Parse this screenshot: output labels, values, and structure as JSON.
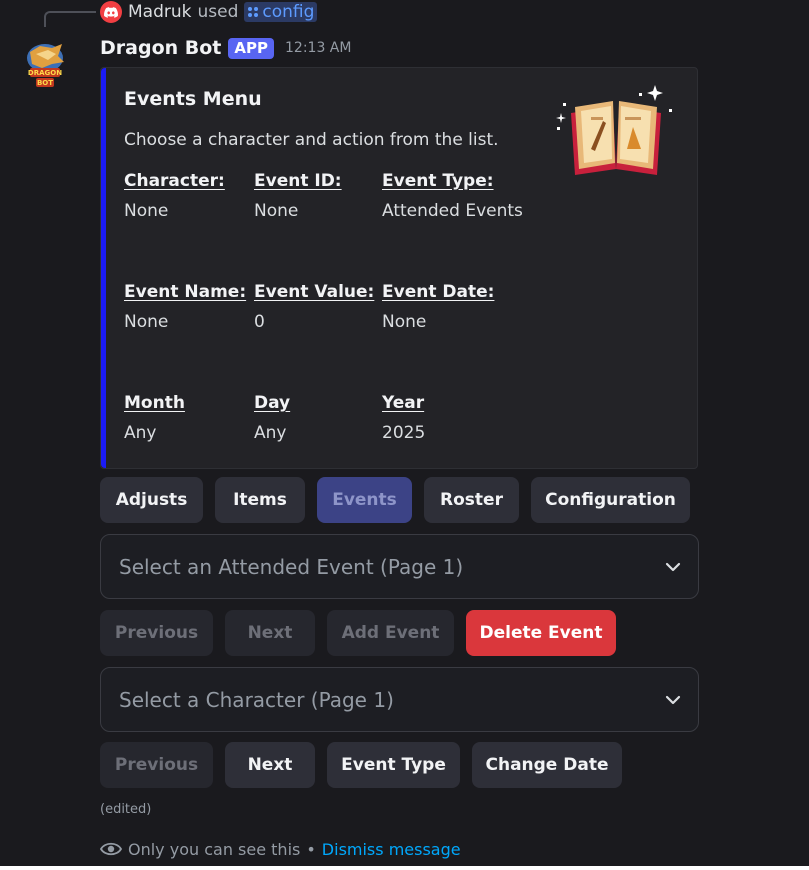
{
  "reply": {
    "user": "Madruk",
    "action_text": "used",
    "command": "config"
  },
  "message": {
    "bot_name": "Dragon Bot",
    "app_tag": "APP",
    "timestamp": "12:13 AM"
  },
  "embed": {
    "accent_color": "#1b1bf5",
    "title": "Events Menu",
    "description": "Choose a character and action from the list.",
    "fields": [
      {
        "name": "Character:",
        "value": "None"
      },
      {
        "name": "Event ID:",
        "value": "None"
      },
      {
        "name": "Event Type:",
        "value": "Attended Events"
      },
      {
        "name": "Event Name:",
        "value": "None"
      },
      {
        "name": "Event Value:",
        "value": "0"
      },
      {
        "name": "Event Date:",
        "value": "None"
      },
      {
        "name": "Month",
        "value": "Any"
      },
      {
        "name": "Day",
        "value": "Any"
      },
      {
        "name": "Year",
        "value": "2025"
      }
    ]
  },
  "nav_buttons": [
    "Adjusts",
    "Items",
    "Events",
    "Roster",
    "Configuration"
  ],
  "event_select": {
    "placeholder": "Select an Attended Event (Page 1)"
  },
  "event_actions": [
    "Previous",
    "Next",
    "Add Event",
    "Delete Event"
  ],
  "character_select": {
    "placeholder": "Select a Character (Page 1)"
  },
  "character_actions": [
    "Previous",
    "Next",
    "Event Type",
    "Change Date"
  ],
  "footer": {
    "edited": "(edited)",
    "ephemeral_text": "Only you can see this",
    "separator": "•",
    "dismiss": "Dismiss message"
  },
  "colors": {
    "danger": "#da373c",
    "blurple": "#5865f2",
    "link": "#00a8fc"
  }
}
